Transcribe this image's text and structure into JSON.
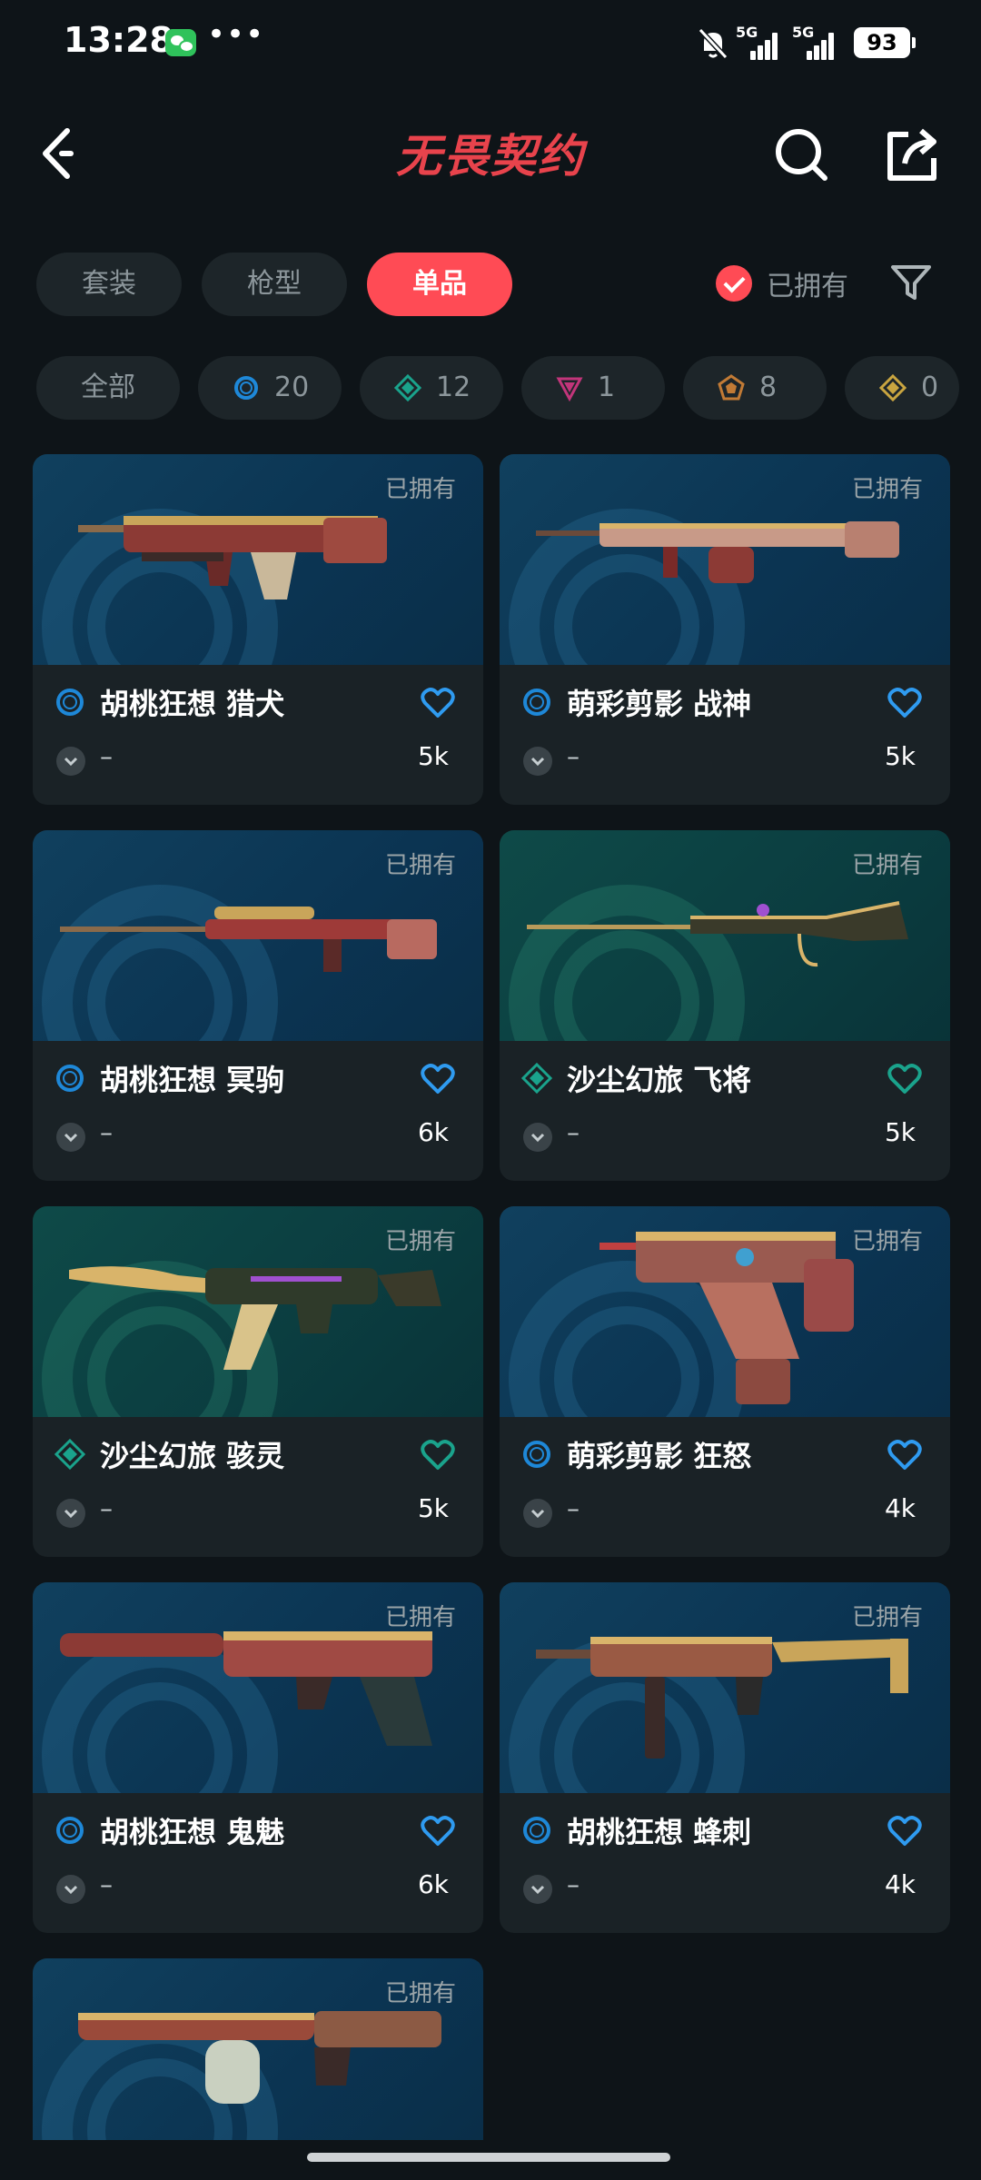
{
  "status_bar": {
    "time": "13:28",
    "more": "•••",
    "network1": "5G",
    "network2": "5G",
    "battery": "93"
  },
  "header": {
    "title": "无畏契约"
  },
  "tabs": [
    {
      "label": "套装",
      "active": false
    },
    {
      "label": "枪型",
      "active": false
    },
    {
      "label": "单品",
      "active": true
    }
  ],
  "owned_filter": {
    "label": "已拥有",
    "checked": true
  },
  "tier_filters": [
    {
      "label": "全部"
    },
    {
      "count": "20",
      "icon": "blue-ring-tier-icon",
      "color": "#1e88d8"
    },
    {
      "count": "12",
      "icon": "green-diamond-tier-icon",
      "color": "#1aa38c"
    },
    {
      "count": "1",
      "icon": "purple-triangle-tier-icon",
      "color": "#c2357a"
    },
    {
      "count": "8",
      "icon": "orange-pentagon-tier-icon",
      "color": "#c17a35"
    },
    {
      "count": "0",
      "icon": "gold-diamond-tier-icon",
      "color": "#c9a540"
    }
  ],
  "items": [
    {
      "name": "胡桃狂想 猎犬",
      "owned_label": "已拥有",
      "level": "–",
      "likes": "5k",
      "tier": "blue",
      "bg": "blue",
      "heart_color": "#2f9bf0"
    },
    {
      "name": "萌彩剪影 战神",
      "owned_label": "已拥有",
      "level": "–",
      "likes": "5k",
      "tier": "blue",
      "bg": "blue",
      "heart_color": "#2f9bf0"
    },
    {
      "name": "胡桃狂想 冥驹",
      "owned_label": "已拥有",
      "level": "–",
      "likes": "6k",
      "tier": "blue",
      "bg": "blue",
      "heart_color": "#2f9bf0"
    },
    {
      "name": "沙尘幻旅 飞将",
      "owned_label": "已拥有",
      "level": "–",
      "likes": "5k",
      "tier": "green",
      "bg": "green",
      "heart_color": "#1aa38c"
    },
    {
      "name": "沙尘幻旅 骇灵",
      "owned_label": "已拥有",
      "level": "–",
      "likes": "5k",
      "tier": "green",
      "bg": "green",
      "heart_color": "#1aa38c"
    },
    {
      "name": "萌彩剪影 狂怒",
      "owned_label": "已拥有",
      "level": "–",
      "likes": "4k",
      "tier": "blue",
      "bg": "blue",
      "heart_color": "#2f9bf0"
    },
    {
      "name": "胡桃狂想 鬼魅",
      "owned_label": "已拥有",
      "level": "–",
      "likes": "6k",
      "tier": "blue",
      "bg": "blue",
      "heart_color": "#2f9bf0"
    },
    {
      "name": "胡桃狂想 蜂刺",
      "owned_label": "已拥有",
      "level": "–",
      "likes": "4k",
      "tier": "blue",
      "bg": "blue",
      "heart_color": "#2f9bf0"
    },
    {
      "owned_label": "已拥有",
      "bg": "blue"
    }
  ]
}
